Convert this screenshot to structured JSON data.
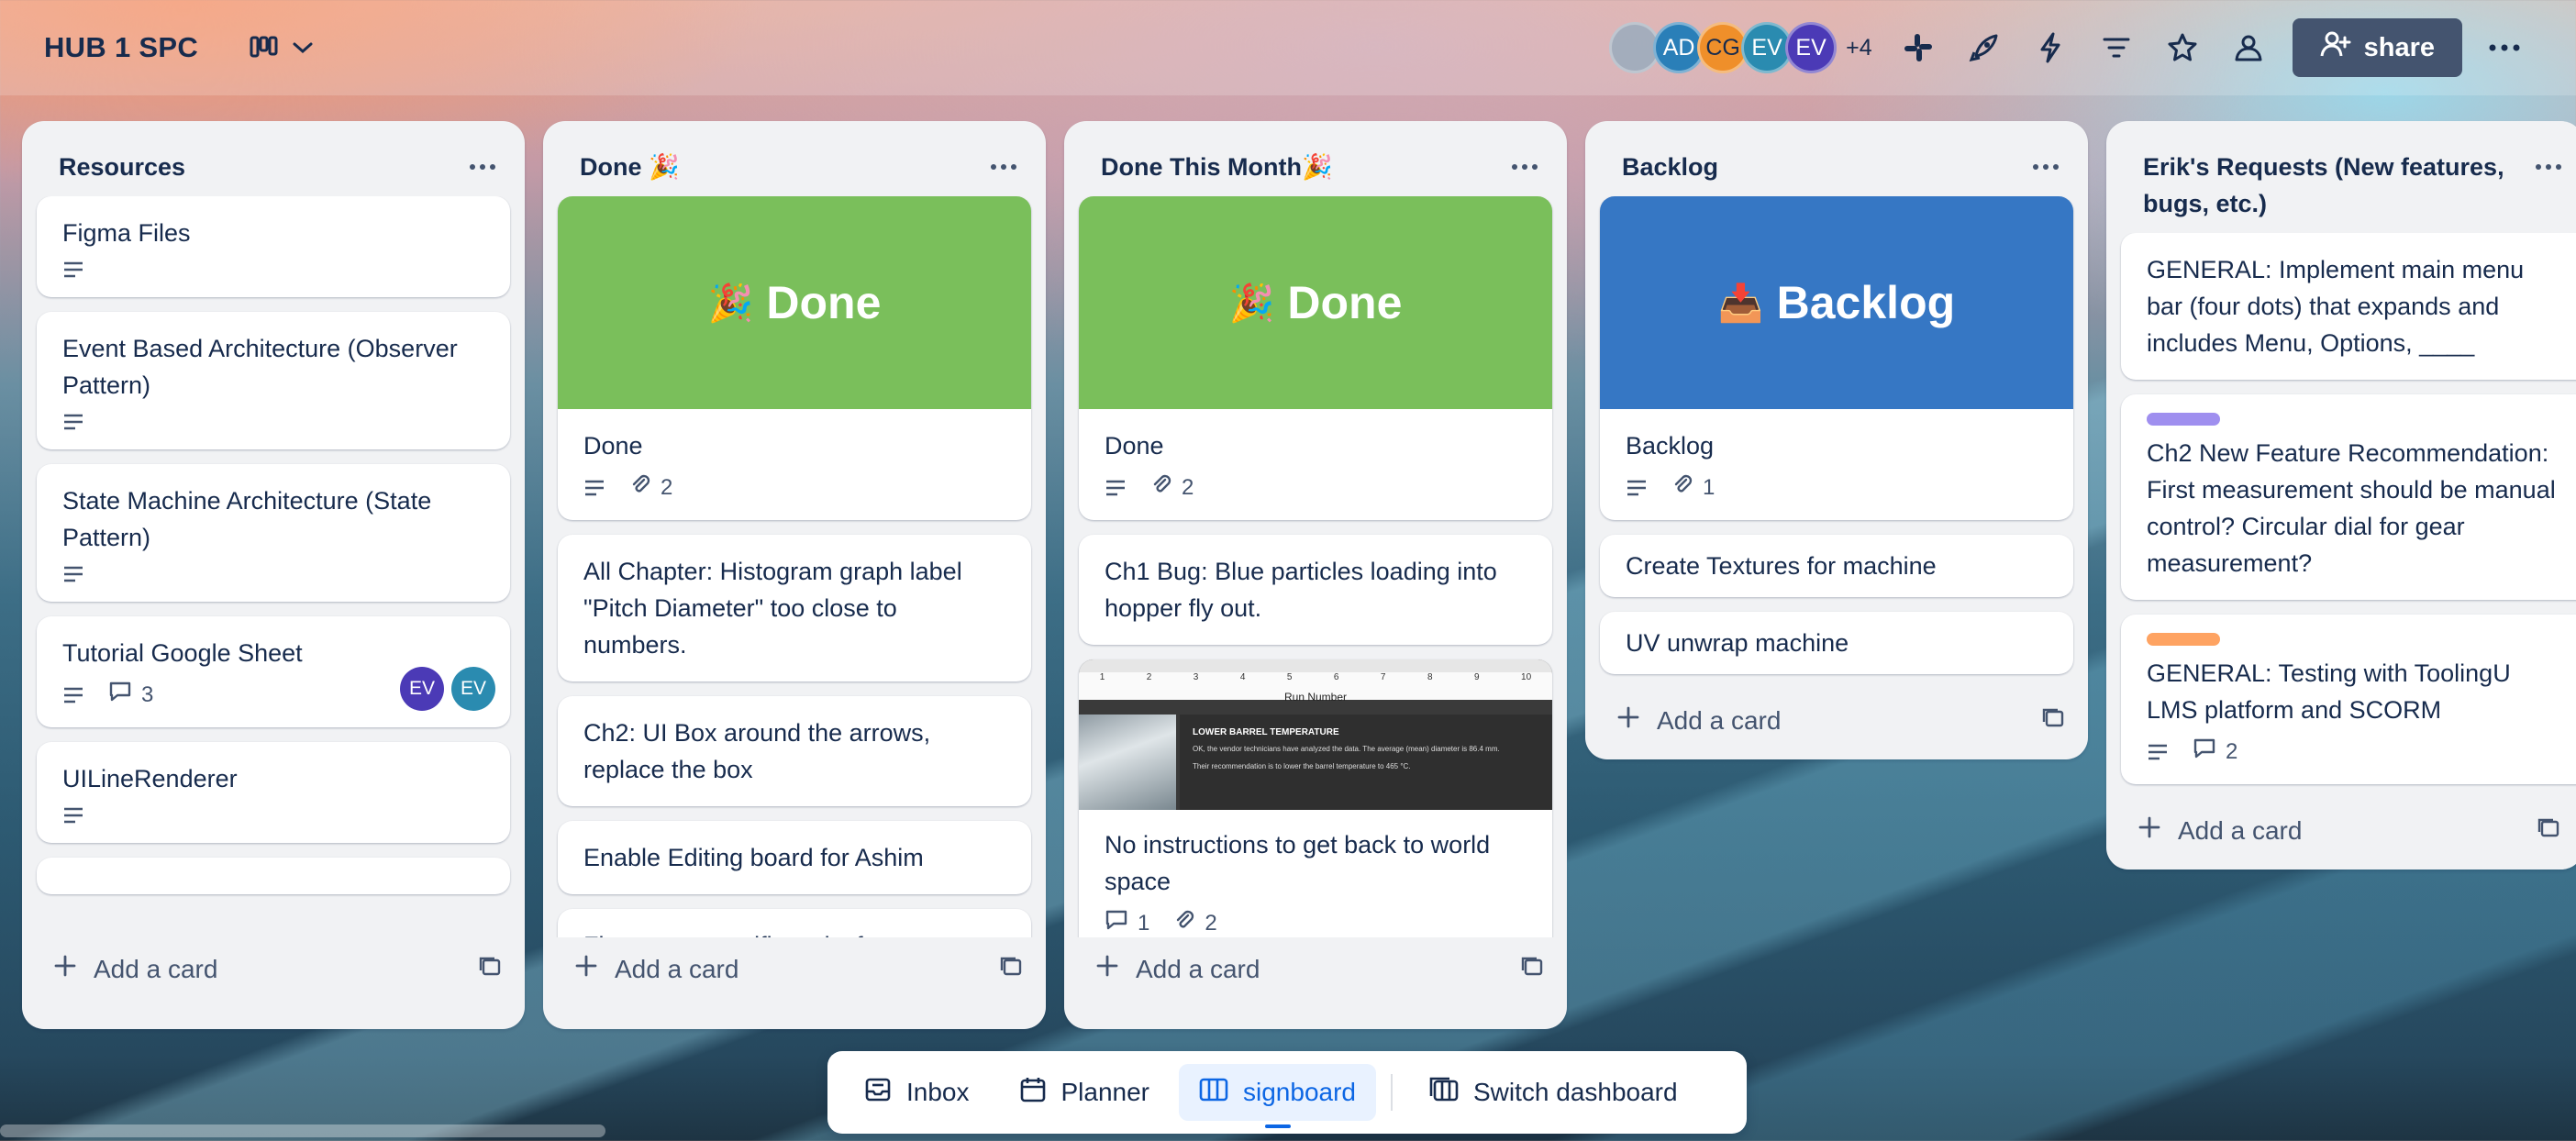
{
  "header": {
    "board_title": "HUB 1 SPC",
    "members": [
      "AD",
      "CG",
      "EV",
      "EV"
    ],
    "members_more": "+4",
    "share_label": "share"
  },
  "lists": [
    {
      "title": "Resources",
      "add_label": "Add a card",
      "cards": [
        {
          "title": "Figma Files"
        },
        {
          "title": "Event Based Architecture (Observer Pattern)"
        },
        {
          "title": "State Machine Architecture (State Pattern)"
        },
        {
          "title": "Tutorial Google Sheet",
          "comments": "3",
          "avatars": [
            "EV",
            "EV"
          ]
        },
        {
          "title": "UILineRenderer"
        }
      ]
    },
    {
      "title": "Done 🎉",
      "add_label": "Add a card",
      "cover_emoji": "🎉",
      "cover_text": "Done",
      "cards": [
        {
          "title": "Done",
          "attachments": "2"
        },
        {
          "title": "All Chapter: Histogram graph label \"Pitch Diameter\" too close to numbers."
        },
        {
          "title": "Ch2: UI Box around the arrows, replace the box"
        },
        {
          "title": "Enable Editing board for Ashim"
        },
        {
          "title": "Figure out specific tasks for"
        }
      ]
    },
    {
      "title": "Done This Month🎉",
      "add_label": "Add a card",
      "cover_emoji": "🎉",
      "cover_text": "Done",
      "cards": [
        {
          "title": "Done",
          "attachments": "2"
        },
        {
          "title": "Ch1 Bug: Blue particles loading into hopper fly out."
        },
        {
          "title": "No instructions to get back to world space",
          "comments": "1",
          "attachments": "2"
        }
      ],
      "screenshot": {
        "axis_label": "Run Number",
        "heading": "LOWER BARREL TEMPERATURE",
        "line1": "OK, the vendor technicians have analyzed the data. The average (mean) diameter is 86.4 mm.",
        "line2": "Their recommendation is to lower the barrel temperature to 465 °C.",
        "ticks": [
          "1",
          "2",
          "3",
          "4",
          "5",
          "6",
          "7",
          "8",
          "9",
          "10"
        ]
      }
    },
    {
      "title": "Backlog",
      "add_label": "Add a card",
      "cover_emoji": "📥",
      "cover_text": "Backlog",
      "cards": [
        {
          "title": "Backlog",
          "attachments": "1"
        },
        {
          "title": "Create Textures for machine"
        },
        {
          "title": "UV unwrap machine"
        }
      ]
    },
    {
      "title": "Erik's Requests (New features, bugs, etc.)",
      "add_label": "Add a card",
      "cards": [
        {
          "title": "GENERAL: Implement main menu bar (four dots) that expands and includes Menu, Options, ____"
        },
        {
          "title": "Ch2 New Feature Recommendation: First measurement should be manual control? Circular dial for gear measurement?",
          "label_color": "#9f8fef"
        },
        {
          "title": "GENERAL: Testing with ToolingU LMS platform and SCORM",
          "label_color": "#fea362",
          "comments": "2"
        }
      ]
    }
  ],
  "bottom_nav": {
    "inbox": "Inbox",
    "planner": "Planner",
    "board": "signboard",
    "switch": "Switch dashboard"
  }
}
